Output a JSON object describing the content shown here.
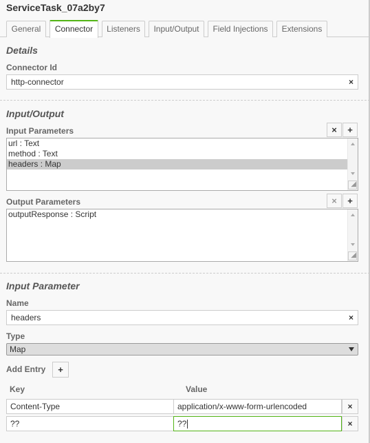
{
  "header": {
    "title": "ServiceTask_07a2by7"
  },
  "tabs": [
    {
      "label": "General"
    },
    {
      "label": "Connector"
    },
    {
      "label": "Listeners"
    },
    {
      "label": "Input/Output"
    },
    {
      "label": "Field Injections"
    },
    {
      "label": "Extensions"
    }
  ],
  "active_tab": "Connector",
  "details": {
    "title": "Details",
    "connector_id_label": "Connector Id",
    "connector_id_value": "http-connector",
    "clear_icon": "×"
  },
  "input_output": {
    "title": "Input/Output",
    "input_params_label": "Input Parameters",
    "input_params": [
      {
        "label": "url : Text",
        "selected": false
      },
      {
        "label": "method : Text",
        "selected": false
      },
      {
        "label": "headers : Map",
        "selected": true
      }
    ],
    "output_params_label": "Output Parameters",
    "output_params": [
      {
        "label": "outputResponse : Script",
        "selected": false
      }
    ],
    "remove_icon": "×",
    "add_icon": "+",
    "resize_grip_icon": "◢"
  },
  "input_parameter": {
    "title": "Input Parameter",
    "name_label": "Name",
    "name_value": "headers",
    "type_label": "Type",
    "type_value": "Map",
    "add_entry_label": "Add Entry",
    "add_icon": "+",
    "key_header": "Key",
    "value_header": "Value",
    "entries": [
      {
        "key": "Content-Type",
        "value": "application/x-www-form-urlencoded"
      },
      {
        "key": "??",
        "value": "??"
      }
    ],
    "remove_icon": "×"
  },
  "colors": {
    "accent": "#52b415",
    "selected_row": "#cccccc",
    "border": "#cccccc"
  }
}
